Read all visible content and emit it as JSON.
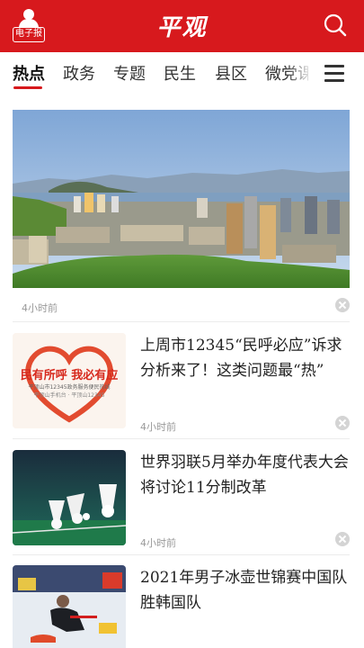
{
  "header": {
    "epaper_label": "电子报",
    "brand": "平观"
  },
  "tabs": [
    {
      "label": "热点"
    },
    {
      "label": "政务"
    },
    {
      "label": "专题"
    },
    {
      "label": "民生"
    },
    {
      "label": "县区"
    },
    {
      "label": "微党课"
    }
  ],
  "articles": [
    {
      "time": "4小时前"
    },
    {
      "title": "上周市12345“民呼必应”诉求分析来了！这类问题最“热”",
      "time": "4小时前",
      "thumb_heading": "民有所呼  我必有应",
      "thumb_sub1": "平顶山市12345政务服务便民热线",
      "thumb_sub2": "平顶山手机台 · 平顶山12345"
    },
    {
      "title": "世界羽联5月举办年度代表大会 将讨论11分制改革",
      "time": "4小时前"
    },
    {
      "title": "2021年男子冰壶世锦赛中国队胜韩国队"
    }
  ]
}
